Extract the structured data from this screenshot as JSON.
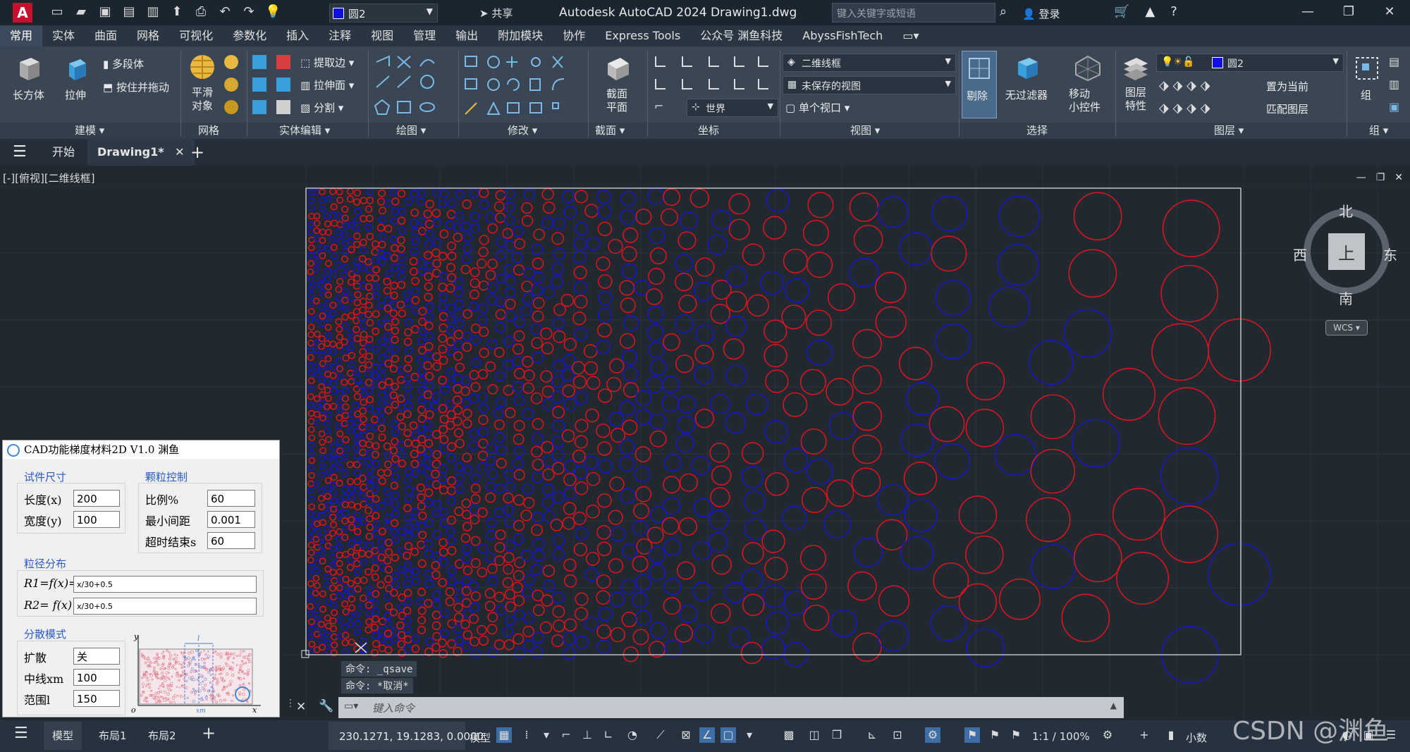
{
  "titlebar": {
    "layer_name": "圆2",
    "share_label": "共享",
    "window_title": "Autodesk AutoCAD 2024    Drawing1.dwg",
    "search_placeholder": "键入关键字或短语",
    "login_label": "登录"
  },
  "ribbon_tabs": [
    "常用",
    "实体",
    "曲面",
    "网格",
    "可视化",
    "参数化",
    "插入",
    "注释",
    "视图",
    "管理",
    "输出",
    "附加模块",
    "协作",
    "Express Tools",
    "公众号 渊鱼科技",
    "AbyssFishTech"
  ],
  "ribbon": {
    "box_label": "长方体",
    "extrude_label": "拉伸",
    "polysolid_label": "多段体",
    "presspull_label": "按住并拖动",
    "smooth_label": "平滑\n对象",
    "extract_edges_label": "提取边",
    "extrude_face_label": "拉伸面",
    "separate_label": "分割",
    "section_plane_label": "截面\n平面",
    "visual_style": "二维线框",
    "view_dropdown": "未保存的视图",
    "ucs_dropdown": "世界",
    "single_viewport": "单个视口",
    "culling_label": "剔除",
    "no_filter_label": "无过滤器",
    "move_gizmo_label": "移动\n小控件",
    "layer_props_label": "图层\n特性",
    "layer_name": "圆2",
    "set_current_label": "置为当前",
    "match_layer_label": "匹配图层",
    "group_label": "组",
    "group_labels": {
      "modeling": "建模",
      "mesh": "网格",
      "solid_edit": "实体编辑",
      "draw": "绘图",
      "modify": "修改",
      "section": "截面",
      "coords": "坐标",
      "view": "视图",
      "selection": "选择",
      "layers": "图层",
      "groups": "组"
    }
  },
  "doc_tabs": {
    "start": "开始",
    "drawing": "Drawing1*"
  },
  "viewport": {
    "label": "[-][俯视][二维线框]",
    "compass": {
      "north": "北",
      "south": "南",
      "east": "东",
      "west": "西",
      "top": "上",
      "wcs": "WCS"
    }
  },
  "plugin": {
    "title": "CAD功能梯度材料2D V1.0 渊鱼",
    "specimen_section": "试件尺寸",
    "length_label": "长度(x)",
    "length_value": "200",
    "width_label": "宽度(y)",
    "width_value": "100",
    "particle_section": "颗粒控制",
    "ratio_label": "比例%",
    "ratio_value": "60",
    "min_gap_label": "最小间距",
    "min_gap_value": "0.001",
    "timeout_label": "超时结束s",
    "timeout_value": "60",
    "size_section": "粒径分布",
    "r1_label": "R1=f(x)=",
    "r1_value": "x/30+0.5",
    "r2_label": "R2= f(x)",
    "r2_value": "x/30+0.5",
    "dispersion_section": "分散模式",
    "diffuse_label": "扩散",
    "diffuse_value": "关",
    "midline_label": "中线xm",
    "midline_value": "100",
    "range_label": "范围l",
    "range_value": "150",
    "preview_y": "y",
    "preview_o": "o",
    "preview_x": "x",
    "preview_xm": "xm",
    "preview_l": "l"
  },
  "command": {
    "history": [
      "命令: _qsave",
      "命令: *取消*"
    ],
    "placeholder": "键入命令"
  },
  "statusbar": {
    "tab_model": "模型",
    "tab_layout1": "布局1",
    "tab_layout2": "布局2",
    "coordinates": "230.1271, 19.1283, 0.0000",
    "model_label": "模型",
    "scale": "1:1 / 100%",
    "units": "小数"
  },
  "watermark": "CSDN @渊鱼",
  "colors": {
    "circle_red": "#e0141e",
    "circle_blue": "#1818c8",
    "background": "#212830"
  }
}
